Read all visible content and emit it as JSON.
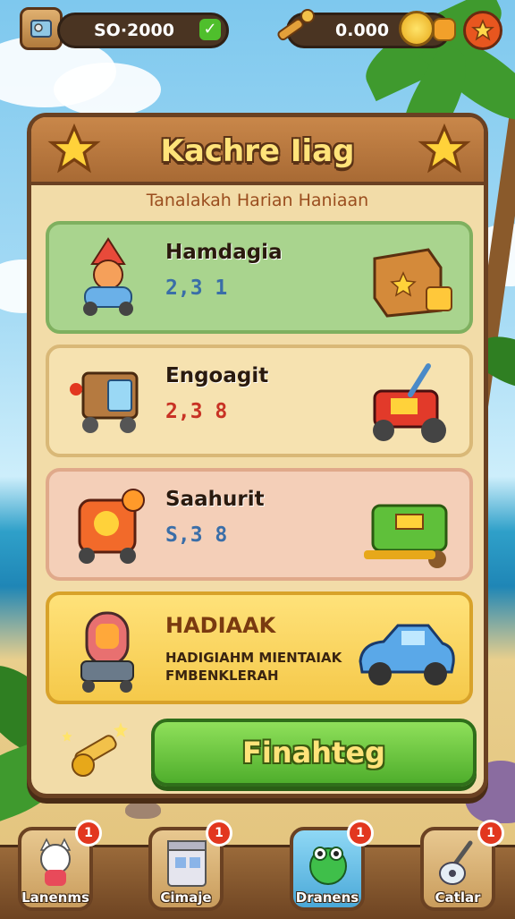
{
  "hud": {
    "left_counter": "SO·2000",
    "right_counter": "0.000"
  },
  "panel": {
    "title": "Kachre Iiag",
    "subtitle": "Tanalakah Harian Haniaan"
  },
  "rewards": [
    {
      "name": "Hamdagia",
      "value": "2,3 1",
      "value_color": "#3a6ea8",
      "card_color": "#a9d48e",
      "border_color": "#7fb05f"
    },
    {
      "name": "Engoagit",
      "value": "2,3 8",
      "value_color": "#c83224",
      "card_color": "#f6e2b0",
      "border_color": "#d9b877"
    },
    {
      "name": "Saahurit",
      "value": "S,3 8",
      "value_color": "#3a6ea8",
      "card_color": "#f4cfb8",
      "border_color": "#e0a98a"
    }
  ],
  "featured": {
    "title": "HADIAAK",
    "description_line1": "HADIGIAHM MIENTAIAK",
    "description_line2": "FMBENKLERAH"
  },
  "action_button": {
    "label": "Finahteg"
  },
  "bottom_nav": [
    {
      "label": "Lanenms",
      "badge": "1"
    },
    {
      "label": "Cimaje",
      "badge": "1"
    },
    {
      "label": "Dranens",
      "badge": "1"
    },
    {
      "label": "Catlar",
      "badge": "1"
    }
  ],
  "colors": {
    "panel_bg": "#f2dca8",
    "panel_border": "#6a4122",
    "title_fill": "#ffe37a",
    "button_green": "#4fae2c"
  }
}
